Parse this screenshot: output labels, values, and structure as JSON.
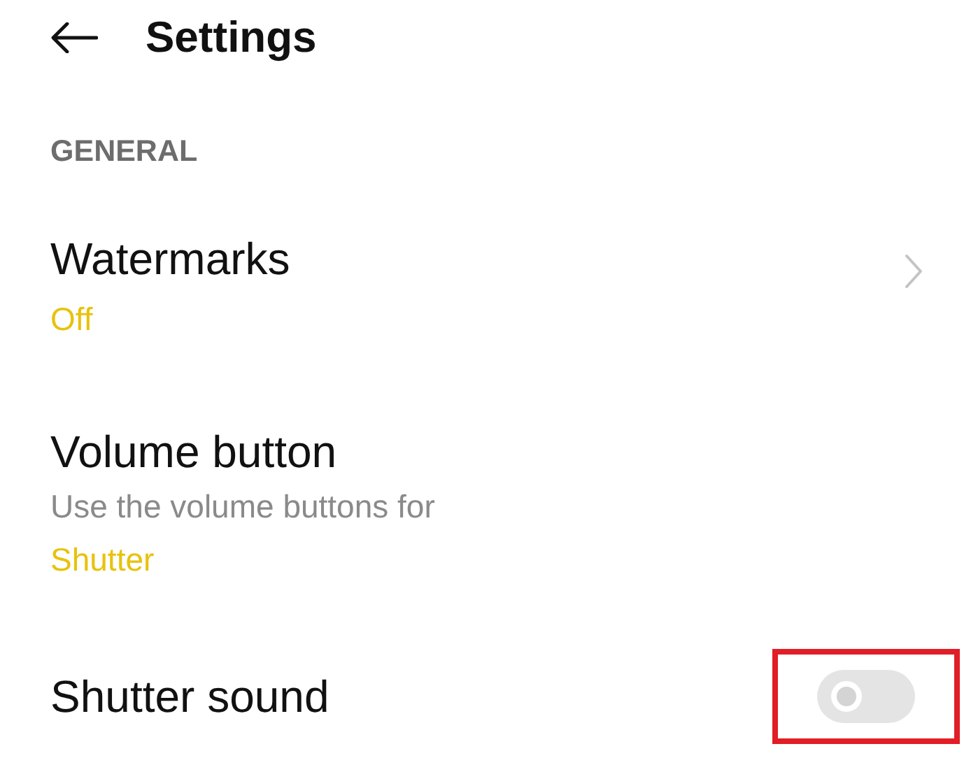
{
  "header": {
    "title": "Settings"
  },
  "section": {
    "label": "GENERAL"
  },
  "items": [
    {
      "kind": "link",
      "title": "Watermarks",
      "value": "Off"
    },
    {
      "kind": "select",
      "title": "Volume button",
      "description": "Use the volume buttons for",
      "value": "Shutter"
    },
    {
      "kind": "toggle",
      "title": "Shutter sound",
      "on": false,
      "highlighted": true
    }
  ]
}
